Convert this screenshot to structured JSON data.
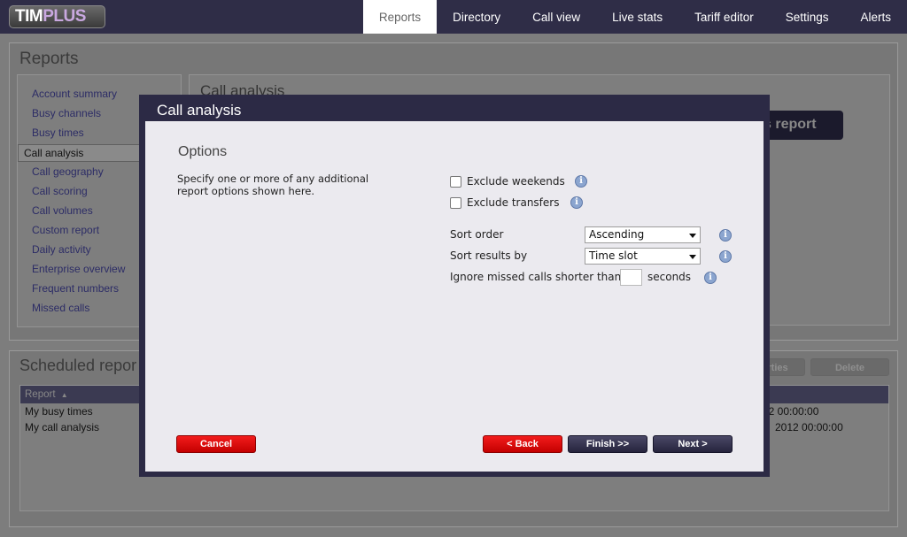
{
  "app": {
    "logo_main": "TIM",
    "logo_accent": "PLUS"
  },
  "nav": {
    "items": [
      "Reports",
      "Directory",
      "Call view",
      "Live stats",
      "Tariff editor",
      "Settings",
      "Alerts"
    ],
    "active": "Reports"
  },
  "reports_panel": {
    "title": "Reports",
    "sidebar": [
      "Account summary",
      "Busy channels",
      "Busy times",
      "Call analysis",
      "Call geography",
      "Call scoring",
      "Call volumes",
      "Custom report",
      "Daily activity",
      "Enterprise overview",
      "Frequent numbers",
      "Missed calls"
    ],
    "selected": "Call analysis",
    "content_title": "Call analysis",
    "run_button_partial": "s report"
  },
  "scheduled_panel": {
    "title": "Scheduled repor",
    "properties_partial": "rties",
    "delete_label": "Delete",
    "column_header": "Report",
    "rows": [
      {
        "name": "My busy times",
        "time_partial": "12 00:00:00"
      },
      {
        "name": "My call analysis",
        "time_partial": "2012 00:00:00"
      }
    ]
  },
  "modal": {
    "title": "Call analysis",
    "section_title": "Options",
    "description": "Specify one or more of any additional report options shown here.",
    "exclude_weekends": {
      "label": "Exclude weekends",
      "checked": false
    },
    "exclude_transfers": {
      "label": "Exclude transfers",
      "checked": false
    },
    "sort_order": {
      "label": "Sort order",
      "value": "Ascending"
    },
    "sort_by": {
      "label": "Sort results by",
      "value": "Time slot"
    },
    "ignore_missed": {
      "label": "Ignore missed calls shorter than",
      "value": "",
      "unit": "seconds"
    },
    "info_glyph": "i",
    "buttons": {
      "cancel": "Cancel",
      "back": "< Back",
      "finish": "Finish >>",
      "next": "Next >"
    }
  }
}
